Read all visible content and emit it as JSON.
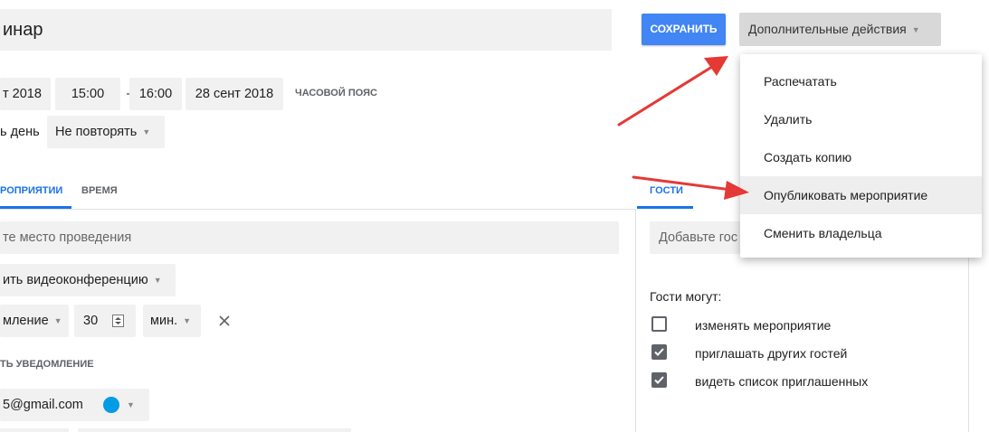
{
  "header": {
    "title": "инар",
    "save_label": "СОХРАНИТЬ",
    "more_actions_label": "Дополнительные действия"
  },
  "datetime": {
    "start_date": "т 2018",
    "start_time": "15:00",
    "dash": "—",
    "end_time": "16:00",
    "end_date": "28 сент 2018",
    "timezone_label": "ЧАСОВОЙ ПОЯС",
    "allday_label": "ь день",
    "repeat_value": "Не повторять"
  },
  "tabs": {
    "details_label": "РОПРИЯТИИ",
    "time_label": "ВРЕМЯ",
    "guests_label": "ГОСТИ"
  },
  "details": {
    "location_placeholder": "те место проведения",
    "conference_label": "ить видеоконференцию",
    "notification_type": "мление",
    "notification_value": "30",
    "notification_unit": "мин.",
    "add_notification_label": "ть уведомление",
    "calendar_email": "5@gmail.com",
    "calendar_color": "#039be5"
  },
  "guests": {
    "add_guests_placeholder": "Добавьте гос",
    "permissions_title": "Гости могут:",
    "permissions": [
      {
        "label": "изменять мероприятие",
        "checked": false
      },
      {
        "label": "приглашать других гостей",
        "checked": true
      },
      {
        "label": "видеть список приглашенных",
        "checked": true
      }
    ]
  },
  "menu": {
    "items": [
      {
        "label": "Распечатать"
      },
      {
        "label": "Удалить"
      },
      {
        "label": "Создать копию"
      },
      {
        "label": "Опубликовать мероприятие"
      },
      {
        "label": "Сменить владельца"
      }
    ]
  },
  "colors": {
    "accent": "#4285f4",
    "tab_accent": "#1a73e8",
    "annotation_arrow": "#e53935"
  }
}
